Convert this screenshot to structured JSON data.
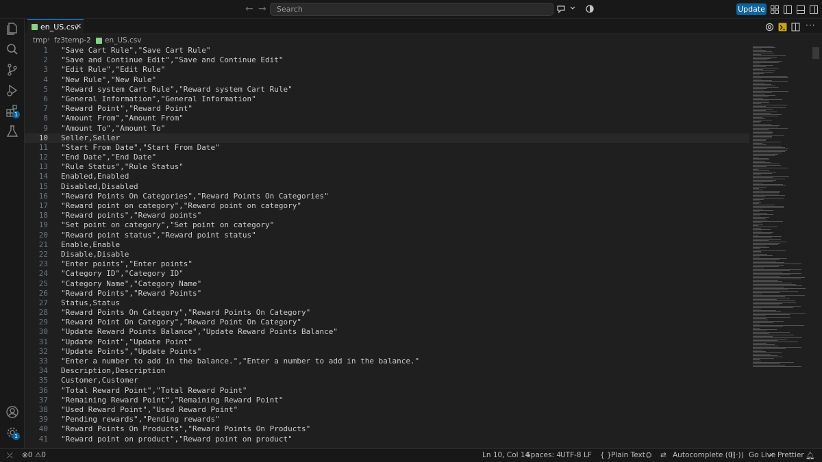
{
  "titlebar": {
    "search_placeholder": "Search",
    "update_label": "Update"
  },
  "activity_bar": {
    "extensions_badge": "1",
    "settings_badge": "1"
  },
  "tab": {
    "label": "en_US.csv",
    "close": "✕"
  },
  "breadcrumb": {
    "items": [
      "tmp",
      "fz3temp-2",
      "en_US.csv"
    ]
  },
  "editor": {
    "current_line": 10,
    "lines": [
      "\"Save Cart Rule\",\"Save Cart Rule\"",
      "\"Save and Continue Edit\",\"Save and Continue Edit\"",
      "\"Edit Rule\",\"Edit Rule\"",
      "\"New Rule\",\"New Rule\"",
      "\"Reward system Cart Rule\",\"Reward system Cart Rule\"",
      "\"General Information\",\"General Information\"",
      "\"Reward Point\",\"Reward Point\"",
      "\"Amount From\",\"Amount From\"",
      "\"Amount To\",\"Amount To\"",
      "Seller,Seller",
      "\"Start From Date\",\"Start From Date\"",
      "\"End Date\",\"End Date\"",
      "\"Rule Status\",\"Rule Status\"",
      "Enabled,Enabled",
      "Disabled,Disabled",
      "\"Reward Points On Categories\",\"Reward Points On Categories\"",
      "\"Reward point on category\",\"Reward point on category\"",
      "\"Reward points\",\"Reward points\"",
      "\"Set point on category\",\"Set point on category\"",
      "\"Reward point status\",\"Reward point status\"",
      "Enable,Enable",
      "Disable,Disable",
      "\"Enter points\",\"Enter points\"",
      "\"Category ID\",\"Category ID\"",
      "\"Category Name\",\"Category Name\"",
      "\"Reward Points\",\"Reward Points\"",
      "Status,Status",
      "\"Reward Points On Category\",\"Reward Points On Category\"",
      "\"Reward Point On Category\",\"Reward Point On Category\"",
      "\"Update Reward Points Balance\",\"Update Reward Points Balance\"",
      "\"Update Point\",\"Update Point\"",
      "\"Update Points\",\"Update Points\"",
      "\"Enter a number to add in the balance.\",\"Enter a number to add in the balance.\"",
      "Description,Description",
      "Customer,Customer",
      "\"Total Reward Point\",\"Total Reward Point\"",
      "\"Remaining Reward Point\",\"Remaining Reward Point\"",
      "\"Used Reward Point\",\"Used Reward Point\"",
      "\"Pending rewards\",\"Pending rewards\"",
      "\"Reward Points On Products\",\"Reward Points On Products\"",
      "\"Reward point on product\",\"Reward point on product\""
    ]
  },
  "statusbar": {
    "errors": "0",
    "warnings": "0",
    "position": "Ln 10, Col 14",
    "spaces": "Spaces: 4",
    "encoding": "UTF-8",
    "eol": "LF",
    "language_braces": "{ }",
    "language": "Plain Text",
    "autocomplete": "Autocomplete (0)",
    "go_live": "Go Live",
    "prettier": "Prettier"
  },
  "colors": {
    "editor_bg": "#1f1f1f",
    "chrome_bg": "#181818",
    "accent": "#0e639c",
    "csv_icon": "#89d185",
    "line_number": "#6e7681"
  }
}
